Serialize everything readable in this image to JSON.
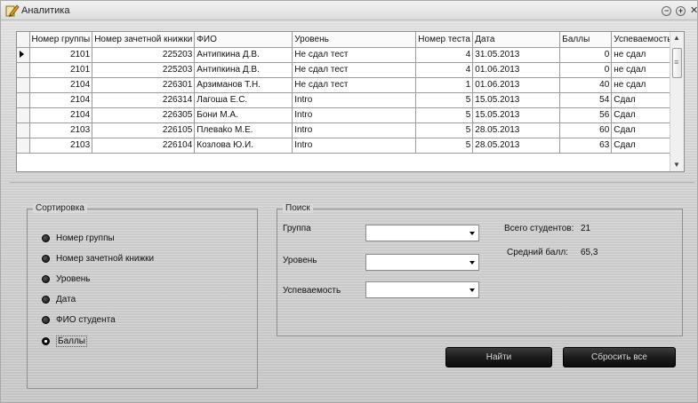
{
  "window": {
    "title": "Аналитика"
  },
  "grid": {
    "columns": [
      "Номер группы",
      "Номер зачетной книжки",
      "ФИО",
      "Уровень",
      "Номер теста",
      "Дата",
      "Баллы",
      "Успеваемость"
    ],
    "rows": [
      [
        "2101",
        "225203",
        "Антипкина Д.В.",
        "Не сдал тест",
        "4",
        "31.05.2013",
        "0",
        "не сдал"
      ],
      [
        "2101",
        "225203",
        "Антипкина Д.В.",
        "Не сдал тест",
        "4",
        "01.06.2013",
        "0",
        "не сдал"
      ],
      [
        "2104",
        "226301",
        "Арзиманов Т.Н.",
        "Не сдал тест",
        "1",
        "01.06.2013",
        "40",
        "не сдал"
      ],
      [
        "2104",
        "226314",
        "Лагоша Е.С.",
        "Intro",
        "5",
        "15.05.2013",
        "54",
        "Сдал"
      ],
      [
        "2104",
        "226305",
        "Бони М.А.",
        "Intro",
        "5",
        "15.05.2013",
        "56",
        "Сдал"
      ],
      [
        "2103",
        "226105",
        "Плеваko М.Е.",
        "Intro",
        "5",
        "28.05.2013",
        "60",
        "Сдал"
      ],
      [
        "2103",
        "226104",
        "Козлова Ю.И.",
        "Intro",
        "5",
        "28.05.2013",
        "63",
        "Сдал"
      ]
    ]
  },
  "sort": {
    "title": "Сортировка",
    "options": [
      "Номер группы",
      "Номер зачетной книжки",
      "Уровень",
      "Дата",
      "ФИО студента",
      "Баллы"
    ]
  },
  "search": {
    "title": "Поиск",
    "group_label": "Группа",
    "level_label": "Уровень",
    "progress_label": "Успеваемость",
    "group_value": "",
    "level_value": "",
    "progress_value": ""
  },
  "stats": {
    "total_label": "Всего студентов:",
    "total_value": "21",
    "avg_label": "Средний балл:",
    "avg_value": "65,3"
  },
  "buttons": {
    "find": "Найти",
    "reset": "Сбросить все"
  }
}
